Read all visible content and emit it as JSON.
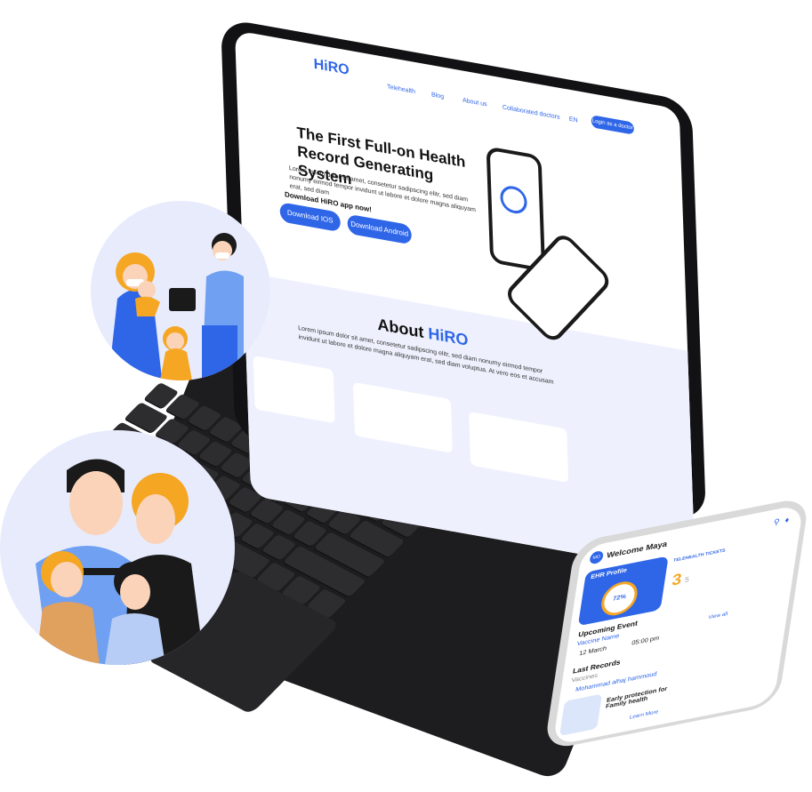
{
  "website": {
    "logo": "HiRO",
    "nav": [
      "Telehealth",
      "Blog",
      "About us",
      "Collaborated doctors",
      "EN"
    ],
    "login_button": "Login as a doctor",
    "hero_title": "The First Full-on Health Record Generating System",
    "hero_text": "Lorem ipsum dolor sit amet, consetetur sadipscing elitr, sed diam nonumy eirmod tempor invidunt ut labore et dolore magna aliquyam erat, sed diam",
    "download_label": "Download HiRO app now!",
    "download_ios": "Download IOS",
    "download_android": "Download Android",
    "about_title_prefix": "About ",
    "about_title_brand": "HiRO",
    "about_text": "Lorem ipsum dolor sit amet, consetetur sadipscing elitr, sed diam nonumy eirmod tempor invidunt ut labore et dolore magna aliquyam erat, sed diam voluptua. At vero eos et accusam"
  },
  "phone_app": {
    "greeting": "Welcome Maya",
    "ehr_title": "EHR Profile",
    "progress": "72%",
    "telehealth_title": "TELEHEALTH TICKETS",
    "tickets": "3",
    "tickets_total": "5",
    "upcoming_title": "Upcoming Event",
    "vaccine_label": "Vaccine Name",
    "event_date": "12 March",
    "event_time": "05:00 pm",
    "view_all": "View all",
    "records_title": "Last Records",
    "records_sub": "Vaccines",
    "records_person": "Mohammad alhaj hammoud",
    "article_title": "Early protection for Family health",
    "read_more": "Learn More"
  },
  "colors": {
    "brand": "#2f66e8",
    "circle_bg": "#e7ebfc",
    "orange": "#f5a623"
  }
}
